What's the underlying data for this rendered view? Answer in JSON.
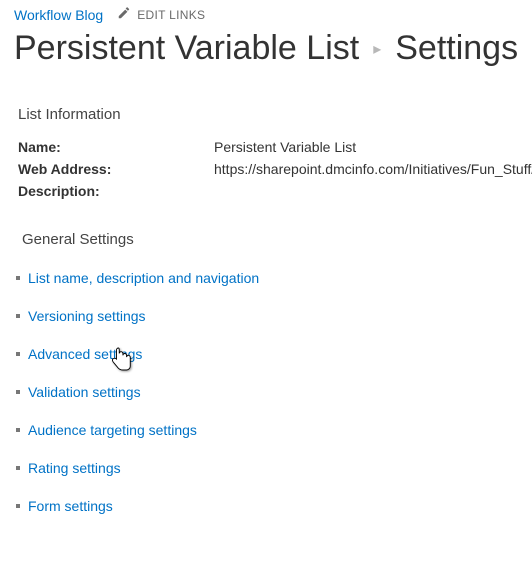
{
  "topbar": {
    "site_link": "Workflow Blog",
    "edit_links_label": "EDIT LINKS"
  },
  "title": {
    "main": "Persistent Variable List",
    "sub": "Settings"
  },
  "list_info": {
    "heading": "List Information",
    "rows": [
      {
        "label": "Name:",
        "value": "Persistent Variable List"
      },
      {
        "label": "Web Address:",
        "value": "https://sharepoint.dmcinfo.com/Initiatives/Fun_Stuff/W"
      },
      {
        "label": "Description:",
        "value": ""
      }
    ]
  },
  "general": {
    "heading": "General Settings",
    "links": [
      "List name, description and navigation",
      "Versioning settings",
      "Advanced settings",
      "Validation settings",
      "Audience targeting settings",
      "Rating settings",
      "Form settings"
    ]
  }
}
